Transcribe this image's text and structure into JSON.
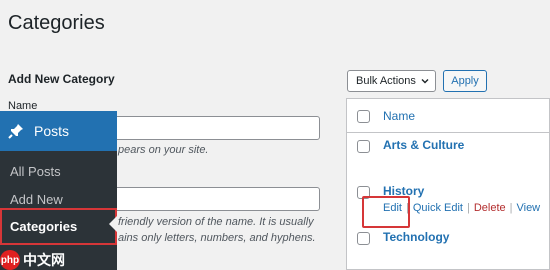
{
  "page": {
    "title": "Categories"
  },
  "add_form": {
    "heading": "Add New Category",
    "name_label": "Name",
    "desc1": "pears on your site.",
    "desc2": "friendly version of the name. It is usually",
    "desc3": "ains only letters, numbers, and hyphens."
  },
  "admin_menu": {
    "posts_label": "Posts",
    "items": [
      "All Posts",
      "Add New",
      "Categories"
    ]
  },
  "bulk": {
    "selected": "Bulk Actions",
    "apply_label": "Apply"
  },
  "table": {
    "column_name": "Name",
    "rows": [
      {
        "name": "Arts & Culture"
      },
      {
        "name": "History"
      },
      {
        "name": "Technology"
      }
    ],
    "row_actions": {
      "edit": "Edit",
      "quick_edit": "Quick Edit",
      "delete": "Delete",
      "view": "View"
    },
    "separator": "|"
  },
  "watermark": {
    "logo": "php",
    "text": "中文网"
  },
  "colors": {
    "accent": "#2271b1",
    "highlight": "#d63638",
    "menu_bg": "#2c3338"
  }
}
